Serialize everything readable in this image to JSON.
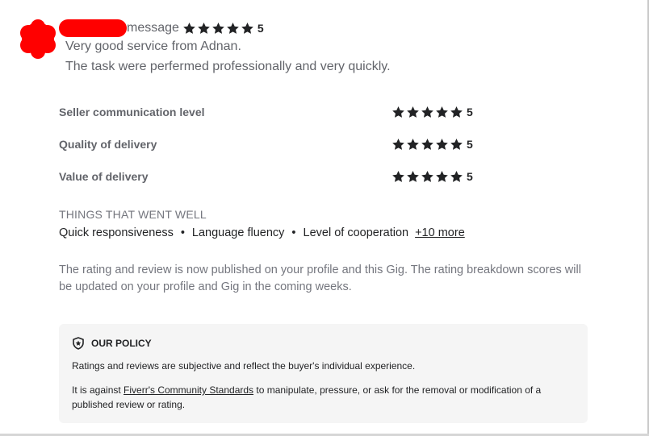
{
  "review": {
    "header_label": "message",
    "header_score": "5",
    "lines": [
      "Very good service from Adnan.",
      "The task were perfermed professionally and very quickly."
    ]
  },
  "ratings": [
    {
      "label": "Seller communication level",
      "score": "5",
      "stars": 5
    },
    {
      "label": "Quality of delivery",
      "score": "5",
      "stars": 5
    },
    {
      "label": "Value of delivery",
      "score": "5",
      "stars": 5
    }
  ],
  "went_well": {
    "title": "THINGS THAT WENT WELL",
    "items": [
      "Quick responsiveness",
      "Language fluency",
      "Level of cooperation"
    ],
    "separator": "•",
    "more_link": "+10 more"
  },
  "notice": "The rating and review is now published on your profile and this Gig. The rating breakdown scores will be updated on your profile and Gig in the coming weeks.",
  "policy": {
    "icon": "shield-star-icon",
    "title": "OUR POLICY",
    "paragraph1": "Ratings and reviews are subjective and reflect the buyer's individual experience.",
    "paragraph2_before": "It is against ",
    "paragraph2_link": "Fiverr's Community Standards",
    "paragraph2_after": " to manipulate, pressure, or ask for the removal or modification of a published review or rating."
  },
  "colors": {
    "redaction": "#ff0000",
    "star": "#222325",
    "policy_bg": "#f5f5f5"
  }
}
